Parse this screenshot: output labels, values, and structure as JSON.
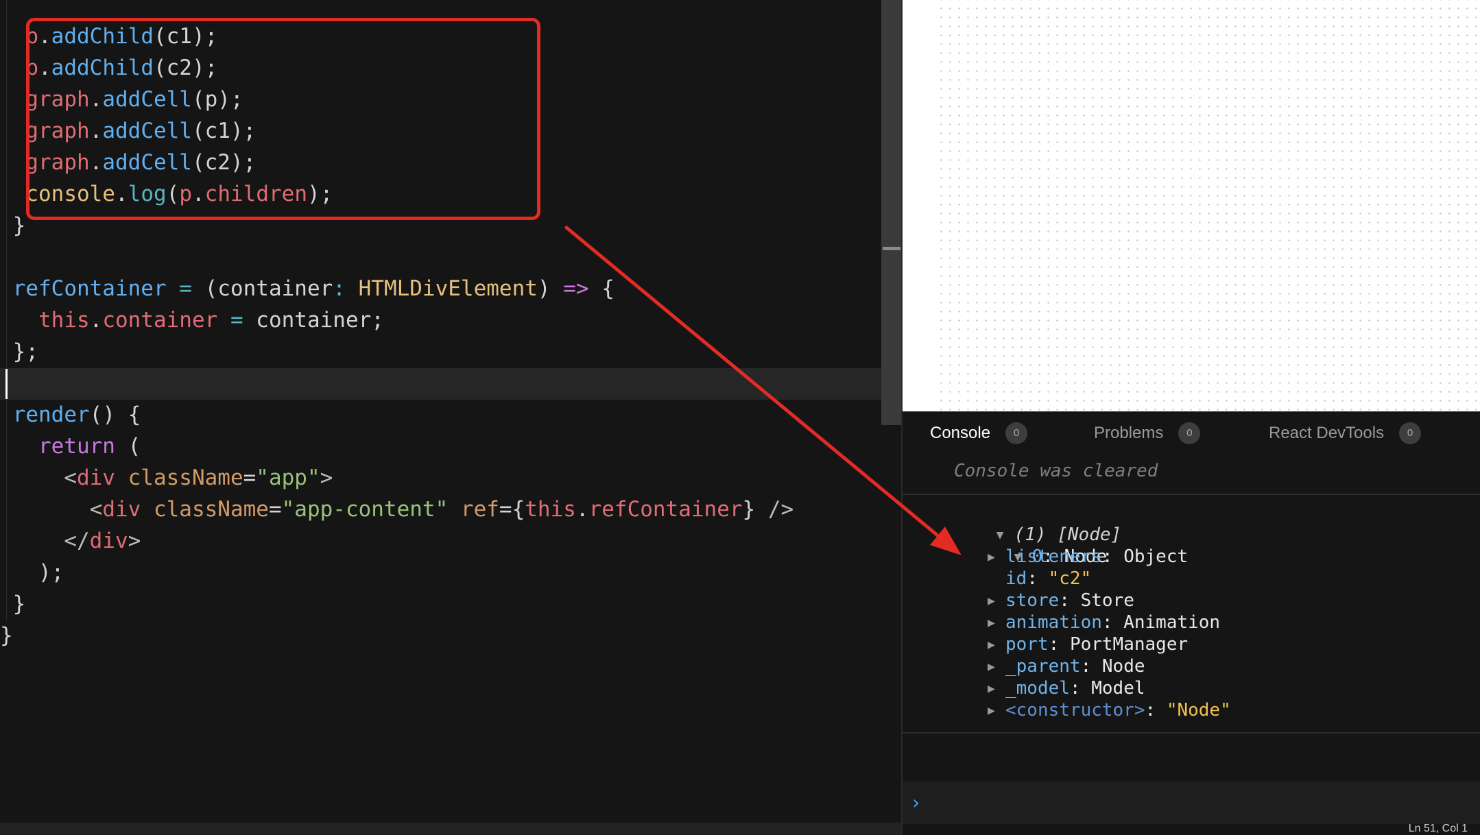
{
  "editor": {
    "lines": [
      [
        [
          "t-var",
          "  p"
        ],
        [
          "t-punc",
          "."
        ],
        [
          "t-fn",
          "addChild"
        ],
        [
          "t-punc",
          "(c1);"
        ]
      ],
      [
        [
          "t-var",
          "  p"
        ],
        [
          "t-punc",
          "."
        ],
        [
          "t-fn",
          "addChild"
        ],
        [
          "t-punc",
          "(c2);"
        ]
      ],
      [
        [
          "t-var",
          "  graph"
        ],
        [
          "t-punc",
          "."
        ],
        [
          "t-fn",
          "addCell"
        ],
        [
          "t-punc",
          "(p);"
        ]
      ],
      [
        [
          "t-var",
          "  graph"
        ],
        [
          "t-punc",
          "."
        ],
        [
          "t-fn",
          "addCell"
        ],
        [
          "t-punc",
          "(c1);"
        ]
      ],
      [
        [
          "t-var",
          "  graph"
        ],
        [
          "t-punc",
          "."
        ],
        [
          "t-fn",
          "addCell"
        ],
        [
          "t-punc",
          "(c2);"
        ]
      ],
      [
        [
          "t-prop",
          "  console"
        ],
        [
          "t-punc",
          "."
        ],
        [
          "t-op",
          "log"
        ],
        [
          "t-punc",
          "("
        ],
        [
          "t-var",
          "p"
        ],
        [
          "t-punc",
          "."
        ],
        [
          "t-var",
          "children"
        ],
        [
          "t-punc",
          ");"
        ]
      ],
      [
        [
          "t-punc",
          " }"
        ]
      ],
      [],
      [
        [
          "t-fn",
          " refContainer"
        ],
        [
          "t-op",
          " ="
        ],
        [
          "t-punc",
          " (container"
        ],
        [
          "t-op",
          ":"
        ],
        [
          "t-type",
          " HTMLDivElement"
        ],
        [
          "t-punc",
          ")"
        ],
        [
          "t-kw",
          " =>"
        ],
        [
          "t-punc",
          " {"
        ]
      ],
      [
        [
          "t-var",
          "   this"
        ],
        [
          "t-punc",
          "."
        ],
        [
          "t-var",
          "container"
        ],
        [
          "t-op",
          " ="
        ],
        [
          "t-punc",
          " container;"
        ]
      ],
      [
        [
          "t-punc",
          " };"
        ]
      ],
      [],
      [
        [
          "t-fn",
          " render"
        ],
        [
          "t-punc",
          "() {"
        ]
      ],
      [
        [
          "t-kw",
          "   return"
        ],
        [
          "t-punc",
          " ("
        ]
      ],
      [
        [
          "t-tagp",
          "     <"
        ],
        [
          "t-tag",
          "div"
        ],
        [
          "t-attr",
          " className"
        ],
        [
          "t-punc",
          "="
        ],
        [
          "t-str",
          "\"app\""
        ],
        [
          "t-tagp",
          ">"
        ]
      ],
      [
        [
          "t-tagp",
          "       <"
        ],
        [
          "t-tag",
          "div"
        ],
        [
          "t-attr",
          " className"
        ],
        [
          "t-punc",
          "="
        ],
        [
          "t-str",
          "\"app-content\""
        ],
        [
          "t-attr",
          " ref"
        ],
        [
          "t-punc",
          "={"
        ],
        [
          "t-var",
          "this"
        ],
        [
          "t-punc",
          "."
        ],
        [
          "t-var",
          "refContainer"
        ],
        [
          "t-punc",
          "}"
        ],
        [
          "t-tagp",
          " />"
        ]
      ],
      [
        [
          "t-tagp",
          "     </"
        ],
        [
          "t-tag",
          "div"
        ],
        [
          "t-tagp",
          ">"
        ]
      ],
      [
        [
          "t-punc",
          "   );"
        ]
      ],
      [
        [
          "t-punc",
          " }"
        ]
      ],
      [
        [
          "t-punc",
          "}"
        ]
      ]
    ]
  },
  "console": {
    "tabs": [
      {
        "label": "Console",
        "count": "0",
        "active": true
      },
      {
        "label": "Problems",
        "count": "0",
        "active": false
      },
      {
        "label": "React DevTools",
        "count": "0",
        "active": false
      }
    ],
    "cleared_message": "Console was cleared",
    "array_summary": "(1) [Node]",
    "item_index": "0",
    "item_type": "Node",
    "properties": [
      {
        "expandable": true,
        "key": "listeners",
        "value": "Object",
        "kind": "plain"
      },
      {
        "expandable": false,
        "key": "id",
        "value": "\"c2\"",
        "kind": "string"
      },
      {
        "expandable": true,
        "key": "store",
        "value": "Store",
        "kind": "plain"
      },
      {
        "expandable": true,
        "key": "animation",
        "value": "Animation",
        "kind": "plain"
      },
      {
        "expandable": true,
        "key": "port",
        "value": "PortManager",
        "kind": "plain"
      },
      {
        "expandable": true,
        "key": "_parent",
        "value": "Node",
        "kind": "plain"
      },
      {
        "expandable": true,
        "key": "_model",
        "value": "Model",
        "kind": "plain"
      },
      {
        "expandable": true,
        "key": "<constructor>",
        "value": "\"Node\"",
        "kind": "ctor"
      }
    ],
    "prompt_symbol": "›",
    "status_text": "Ln 51, Col 1"
  },
  "colors": {
    "annotation_red": "#e32b23",
    "editor_bg": "#151515",
    "preview_bg": "#ffffff"
  }
}
